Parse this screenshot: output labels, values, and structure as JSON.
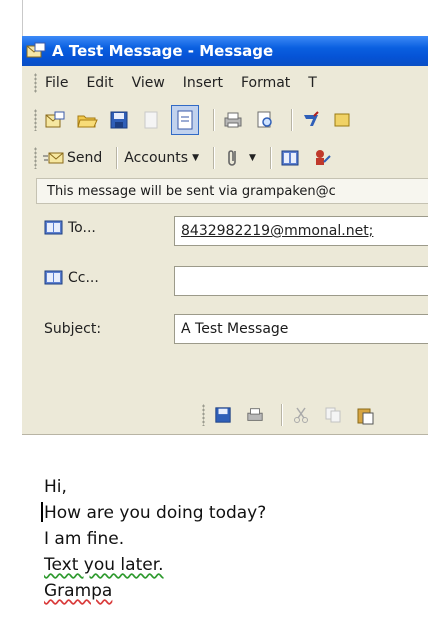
{
  "window": {
    "title": "A Test Message - Message"
  },
  "menu": {
    "items": [
      "File",
      "Edit",
      "View",
      "Insert",
      "Format",
      "T"
    ]
  },
  "toolbar": {
    "icons": [
      "new-message-icon",
      "open-folder-icon",
      "save-icon",
      "print-preview-icon",
      "attach-page-icon",
      "print-icon",
      "find-icon",
      "spelling-icon",
      "options-icon"
    ],
    "send_label": "Send",
    "accounts_label": "Accounts"
  },
  "infobar": {
    "text": "This message will be sent via grampaken@c"
  },
  "header": {
    "to_label": "To...",
    "to_value": "8432982219@mmonal.net;",
    "cc_label": "Cc...",
    "cc_value": "",
    "subject_label": "Subject:",
    "subject_value": "A Test Message"
  },
  "message": {
    "lines": [
      "Hi,",
      "How are you doing today?",
      "I am fine.",
      "Text you later.",
      "Grampa"
    ]
  },
  "colors": {
    "titlebar": "#0553d6",
    "chrome": "#ece9d8",
    "accent": "#316ac5"
  }
}
